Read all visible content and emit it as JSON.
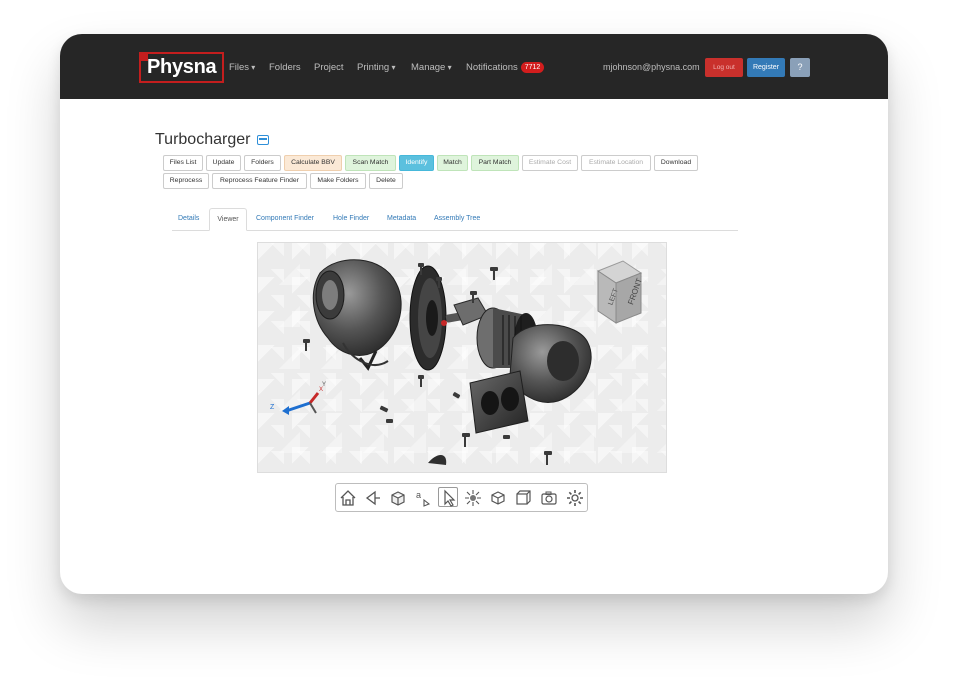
{
  "nav": {
    "logo": "Physna",
    "items": [
      "Files",
      "Folders",
      "Project",
      "Printing",
      "Manage"
    ],
    "notifications_label": "Notifications",
    "notifications_count": "7712",
    "user_email": "mjohnson@physna.com",
    "logout": "Log out",
    "register": "Register",
    "help": "?"
  },
  "page": {
    "title": "Turbocharger"
  },
  "toolbar": {
    "row1": [
      "Files List",
      "Update",
      "Folders",
      "Calculate BBV",
      "Scan Match",
      "Identify",
      "Match",
      "Part Match",
      "Estimate Cost",
      "Estimate Location",
      "Download"
    ],
    "row2": [
      "Reprocess",
      "Reprocess Feature Finder",
      "Make Folders",
      "Delete"
    ]
  },
  "tabs": [
    "Details",
    "Viewer",
    "Component Finder",
    "Hole Finder",
    "Metadata",
    "Assembly Tree"
  ],
  "viewer": {
    "cube_front": "FRONT",
    "cube_left": "LEFT",
    "axis_x": "X",
    "axis_y": "Y",
    "axis_z": "Z"
  },
  "viewer_tools": [
    "home-icon",
    "rewind-icon",
    "cube-view-icon",
    "annotation-icon",
    "select-cursor-icon",
    "explode-icon",
    "assembly-icon",
    "section-box-icon",
    "camera-icon",
    "settings-gear-icon"
  ],
  "colors": {
    "navbar": "#262626",
    "brand_red": "#c41e1e",
    "primary_blue": "#337ab7",
    "info_blue": "#5bc0de",
    "success_green": "#dff4dc",
    "warning_orange": "#fbe9d6"
  }
}
